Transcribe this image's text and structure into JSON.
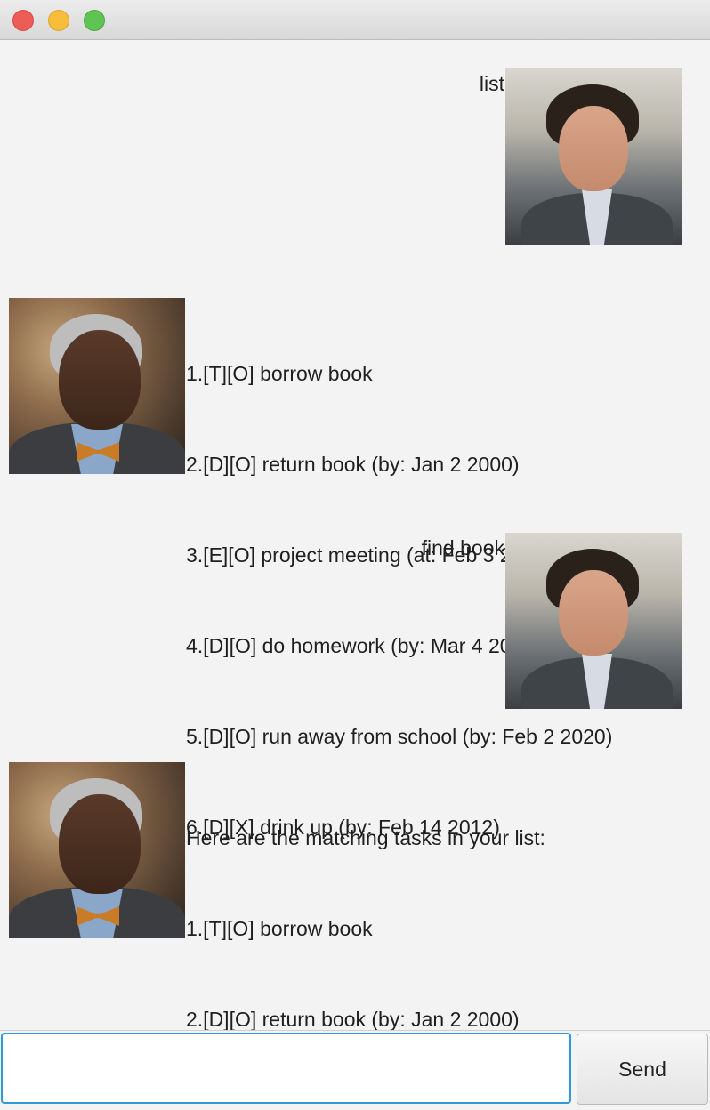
{
  "window": {
    "buttons": [
      "close",
      "minimize",
      "maximize"
    ]
  },
  "conversation": [
    {
      "role": "user",
      "text": "list",
      "avatar": "user-portrait"
    },
    {
      "role": "bot",
      "lines": [
        "1.[T][O] borrow book",
        "2.[D][O] return book (by: Jan 2 2000)",
        "3.[E][O] project meeting (at: Feb 3 2001)",
        "4.[D][O] do homework (by: Mar 4 2002)",
        "5.[D][O] run away from school (by: Feb 2 2020)",
        "6.[D][X] drink up (by: Feb 14 2012)"
      ],
      "avatar": "bot-portrait"
    },
    {
      "role": "user",
      "text": "find book",
      "avatar": "user-portrait"
    },
    {
      "role": "bot",
      "lines": [
        "Here are the matching tasks in your list:",
        "1.[T][O] borrow book",
        "2.[D][O] return book (by: Jan 2 2000)"
      ],
      "avatar": "bot-portrait"
    }
  ],
  "input": {
    "value": "",
    "placeholder": ""
  },
  "send_button": {
    "label": "Send"
  },
  "colors": {
    "background": "#f3f3f3",
    "input_focus_border": "#2e9ad6",
    "close": "#ee5c56",
    "minimize": "#f8bd3a",
    "maximize": "#5fc454"
  }
}
